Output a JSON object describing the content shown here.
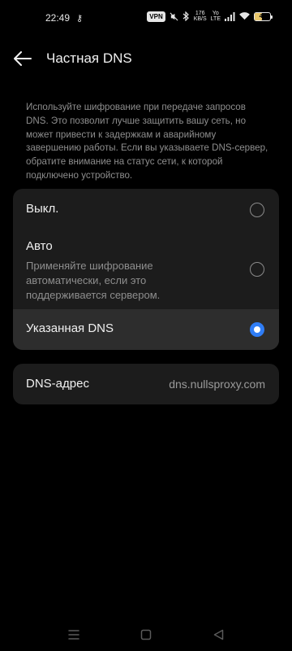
{
  "status_bar": {
    "time": "22:49",
    "key_glyph": "⚷",
    "vpn": "VPN",
    "speed_value": "176",
    "speed_unit": "KB/S",
    "net_type_top": "Yo",
    "net_type_bottom": "LTE",
    "battery_level": "45",
    "icons": [
      "key-icon",
      "vpn-icon",
      "mute-icon",
      "bluetooth-icon",
      "speed-icon",
      "volte-icon",
      "signal-icon",
      "wifi-icon",
      "battery-icon"
    ]
  },
  "header": {
    "title": "Частная DNS",
    "back_icon": "arrow-left-icon"
  },
  "description": "Используйте шифрование при передаче запросов DNS. Это позволит лучше защитить вашу сеть, но может привести к задержкам и аварийному завершению работы. Если вы указываете DNS-сервер, обратите внимание на статус сети, к которой подключено устройство.",
  "options": [
    {
      "label": "Выкл.",
      "subtitle": "",
      "selected": false
    },
    {
      "label": "Авто",
      "subtitle": "Применяйте шифрование автоматически, если это поддерживается сервером.",
      "selected": false
    },
    {
      "label": "Указанная DNS",
      "subtitle": "",
      "selected": true
    }
  ],
  "dns_address": {
    "label": "DNS-адрес",
    "value": "dns.nullsproxy.com"
  },
  "nav_bar": {
    "icons": [
      "menu-icon",
      "home-icon",
      "back-triangle-icon"
    ]
  },
  "colors": {
    "background": "#000000",
    "card": "#1c1c1c",
    "selected_row": "#2d2d2d",
    "accent": "#2f7df6",
    "secondary_text": "#8e8e8e"
  }
}
